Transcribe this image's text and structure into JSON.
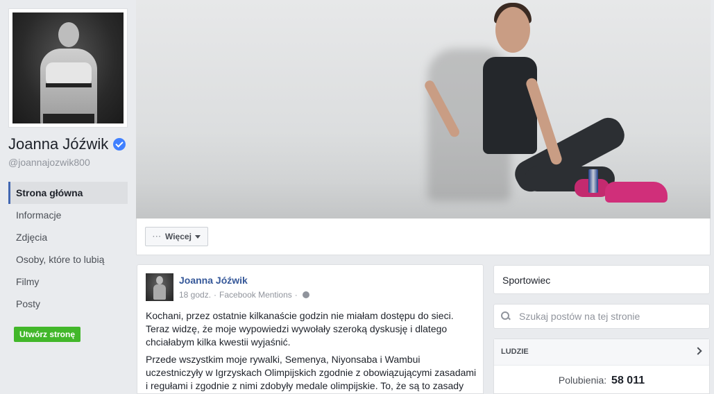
{
  "profile": {
    "name": "Joanna Jóźwik",
    "handle": "@joannajozwik800"
  },
  "nav": {
    "items": [
      {
        "label": "Strona główna",
        "active": true
      },
      {
        "label": "Informacje",
        "active": false
      },
      {
        "label": "Zdjęcia",
        "active": false
      },
      {
        "label": "Osoby, które to lubią",
        "active": false
      },
      {
        "label": "Filmy",
        "active": false
      },
      {
        "label": "Posty",
        "active": false
      }
    ],
    "create_page_label": "Utwórz stronę"
  },
  "action_bar": {
    "more_dots": "···",
    "more_label": "Więcej"
  },
  "post": {
    "author": "Joanna Jóźwik",
    "time": "18 godz.",
    "source": "Facebook Mentions",
    "separator": "·",
    "paragraph1": "Kochani, przez ostatnie kilkanaście godzin nie miałam dostępu do sieci. Teraz widzę, że moje wypowiedzi wywołały szeroką dyskusję i dlatego chciałabym kilka kwestii wyjaśnić.",
    "paragraph2": "Przede wszystkim moje rywalki, Semenya, Niyonsaba i Wambui uczestniczyły w Igrzyskach Olimpijskich zgodnie z obowiązującymi zasadami i regułami i zgodnie z nimi zdobyły medale olimpijskie. To, że są to zasady wzbudzające"
  },
  "sidebar_right": {
    "category": "Sportowiec",
    "search_placeholder": "Szukaj postów na tej stronie",
    "people_header": "LUDZIE",
    "likes_label": "Polubienia:",
    "likes_count": "58 011"
  },
  "colors": {
    "accent": "#4267b2",
    "link": "#365899",
    "verified": "#4080ff",
    "create_button": "#42b72a"
  }
}
